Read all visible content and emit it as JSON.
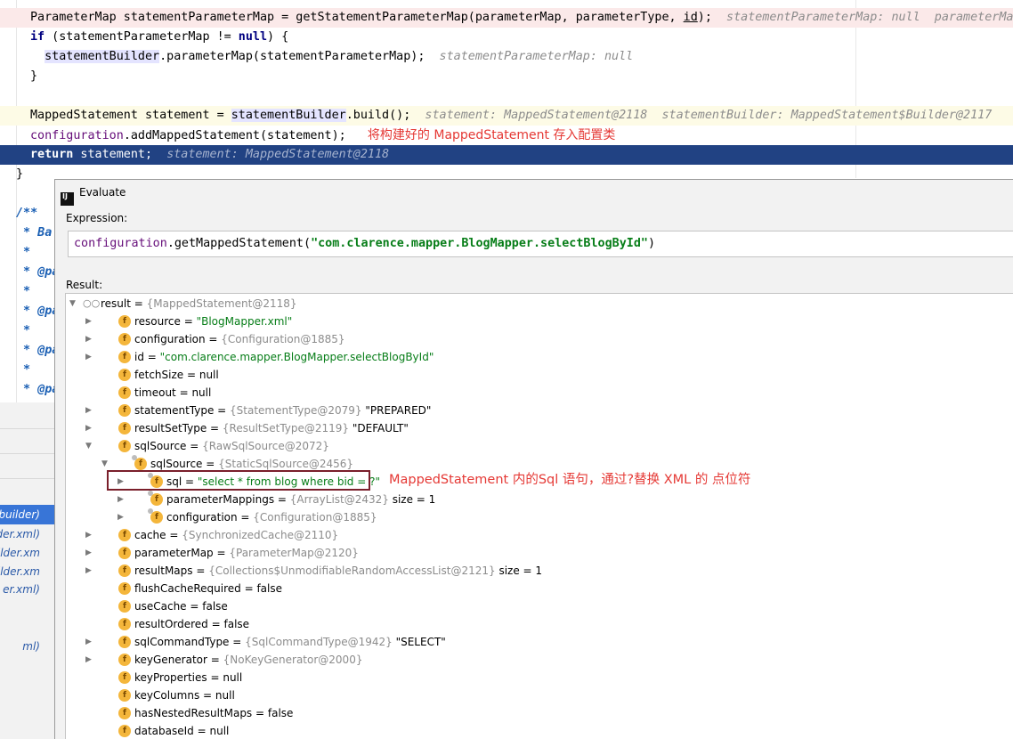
{
  "editor": {
    "lines": [
      {
        "code": "ParameterMap statementParameterMap = getStatementParameterMap(parameterMap, parameterType, id);",
        "hint": "statementParameterMap: null  parameterMap"
      },
      {
        "code": "if (statementParameterMap != null) {",
        "hint": ""
      },
      {
        "code": "  statementBuilder.parameterMap(statementParameterMap);",
        "hint": "statementParameterMap: null"
      },
      {
        "code": "}",
        "hint": ""
      },
      {
        "code": "MappedStatement statement = statementBuilder.build();",
        "hint": "statement: MappedStatement@2118  statementBuilder: MappedStatement$Builder@2117"
      },
      {
        "code": "configuration.addMappedStatement(statement);",
        "hint": ""
      },
      {
        "code": "return statement;",
        "hint": "statement: MappedStatement@2118"
      },
      {
        "code": "}",
        "hint": ""
      }
    ],
    "note": "将构建好的 MappedStatement 存入配置类",
    "comment_lines": [
      "/**",
      " * Ba",
      " *",
      " * @pa",
      " *",
      " * @pa",
      " *",
      " * @pa",
      " *",
      " * @pa"
    ]
  },
  "left_panel": {
    "items": [
      "builder)",
      "der.xml)",
      ".builder.xm",
      ".builder.xm",
      "er.xml)",
      "",
      "ml)"
    ]
  },
  "dialog": {
    "title": "Evaluate",
    "expression_label": "Expression:",
    "expression_obj": "configuration",
    "expression_method": ".getMappedStatement(",
    "expression_arg": "\"com.clarence.mapper.BlogMapper.selectBlogById\"",
    "expression_close": ")",
    "result_label": "Result:",
    "tree": [
      {
        "depth": 0,
        "arrow": "▼",
        "icon": "glasses",
        "name": "result",
        "type": "{MappedStatement@2118}",
        "value": "",
        "extra": ""
      },
      {
        "depth": 1,
        "arrow": "▶",
        "icon": "f",
        "name": "resource",
        "type": "",
        "value": "\"BlogMapper.xml\"",
        "extra": ""
      },
      {
        "depth": 1,
        "arrow": "▶",
        "icon": "f",
        "name": "configuration",
        "type": "{Configuration@1885}",
        "value": "",
        "extra": ""
      },
      {
        "depth": 1,
        "arrow": "▶",
        "icon": "f",
        "name": "id",
        "type": "",
        "value": "\"com.clarence.mapper.BlogMapper.selectBlogById\"",
        "extra": ""
      },
      {
        "depth": 1,
        "arrow": "",
        "icon": "f",
        "name": "fetchSize",
        "type": "",
        "value": "",
        "extra": "null"
      },
      {
        "depth": 1,
        "arrow": "",
        "icon": "f",
        "name": "timeout",
        "type": "",
        "value": "",
        "extra": "null"
      },
      {
        "depth": 1,
        "arrow": "▶",
        "icon": "f",
        "name": "statementType",
        "type": "{StatementType@2079}",
        "value": "",
        "extra": "\"PREPARED\""
      },
      {
        "depth": 1,
        "arrow": "▶",
        "icon": "f",
        "name": "resultSetType",
        "type": "{ResultSetType@2119}",
        "value": "",
        "extra": "\"DEFAULT\""
      },
      {
        "depth": 1,
        "arrow": "▼",
        "icon": "f",
        "name": "sqlSource",
        "type": "{RawSqlSource@2072}",
        "value": "",
        "extra": ""
      },
      {
        "depth": 2,
        "arrow": "▼",
        "icon": "f-lock",
        "name": "sqlSource",
        "type": "{StaticSqlSource@2456}",
        "value": "",
        "extra": ""
      },
      {
        "depth": 3,
        "arrow": "▶",
        "icon": "f-lock",
        "name": "sql",
        "type": "",
        "value": "\"select * from blog where bid = ?\"",
        "extra": ""
      },
      {
        "depth": 3,
        "arrow": "▶",
        "icon": "f-lock",
        "name": "parameterMappings",
        "type": "{ArrayList@2432}",
        "value": "",
        "extra": "size = 1"
      },
      {
        "depth": 3,
        "arrow": "▶",
        "icon": "f-lock",
        "name": "configuration",
        "type": "{Configuration@1885}",
        "value": "",
        "extra": ""
      },
      {
        "depth": 1,
        "arrow": "▶",
        "icon": "f",
        "name": "cache",
        "type": "{SynchronizedCache@2110}",
        "value": "",
        "extra": ""
      },
      {
        "depth": 1,
        "arrow": "▶",
        "icon": "f",
        "name": "parameterMap",
        "type": "{ParameterMap@2120}",
        "value": "",
        "extra": ""
      },
      {
        "depth": 1,
        "arrow": "▶",
        "icon": "f",
        "name": "resultMaps",
        "type": "{Collections$UnmodifiableRandomAccessList@2121}",
        "value": "",
        "extra": "size = 1"
      },
      {
        "depth": 1,
        "arrow": "",
        "icon": "f",
        "name": "flushCacheRequired",
        "type": "",
        "value": "",
        "extra": "false"
      },
      {
        "depth": 1,
        "arrow": "",
        "icon": "f",
        "name": "useCache",
        "type": "",
        "value": "",
        "extra": "false"
      },
      {
        "depth": 1,
        "arrow": "",
        "icon": "f",
        "name": "resultOrdered",
        "type": "",
        "value": "",
        "extra": "false"
      },
      {
        "depth": 1,
        "arrow": "▶",
        "icon": "f",
        "name": "sqlCommandType",
        "type": "{SqlCommandType@1942}",
        "value": "",
        "extra": "\"SELECT\""
      },
      {
        "depth": 1,
        "arrow": "▶",
        "icon": "f",
        "name": "keyGenerator",
        "type": "{NoKeyGenerator@2000}",
        "value": "",
        "extra": ""
      },
      {
        "depth": 1,
        "arrow": "",
        "icon": "f",
        "name": "keyProperties",
        "type": "",
        "value": "",
        "extra": "null"
      },
      {
        "depth": 1,
        "arrow": "",
        "icon": "f",
        "name": "keyColumns",
        "type": "",
        "value": "",
        "extra": "null"
      },
      {
        "depth": 1,
        "arrow": "",
        "icon": "f",
        "name": "hasNestedResultMaps",
        "type": "",
        "value": "",
        "extra": "false"
      },
      {
        "depth": 1,
        "arrow": "",
        "icon": "f",
        "name": "databaseId",
        "type": "",
        "value": "",
        "extra": "null"
      }
    ],
    "sql_note": "MappedStatement 内的Sql 语句，通过?替换 XML 的 点位符"
  },
  "colors": {
    "selection": "#214283",
    "annotation_red": "#e53935",
    "field_icon": "#f4b63b",
    "string_green": "#067d17"
  }
}
